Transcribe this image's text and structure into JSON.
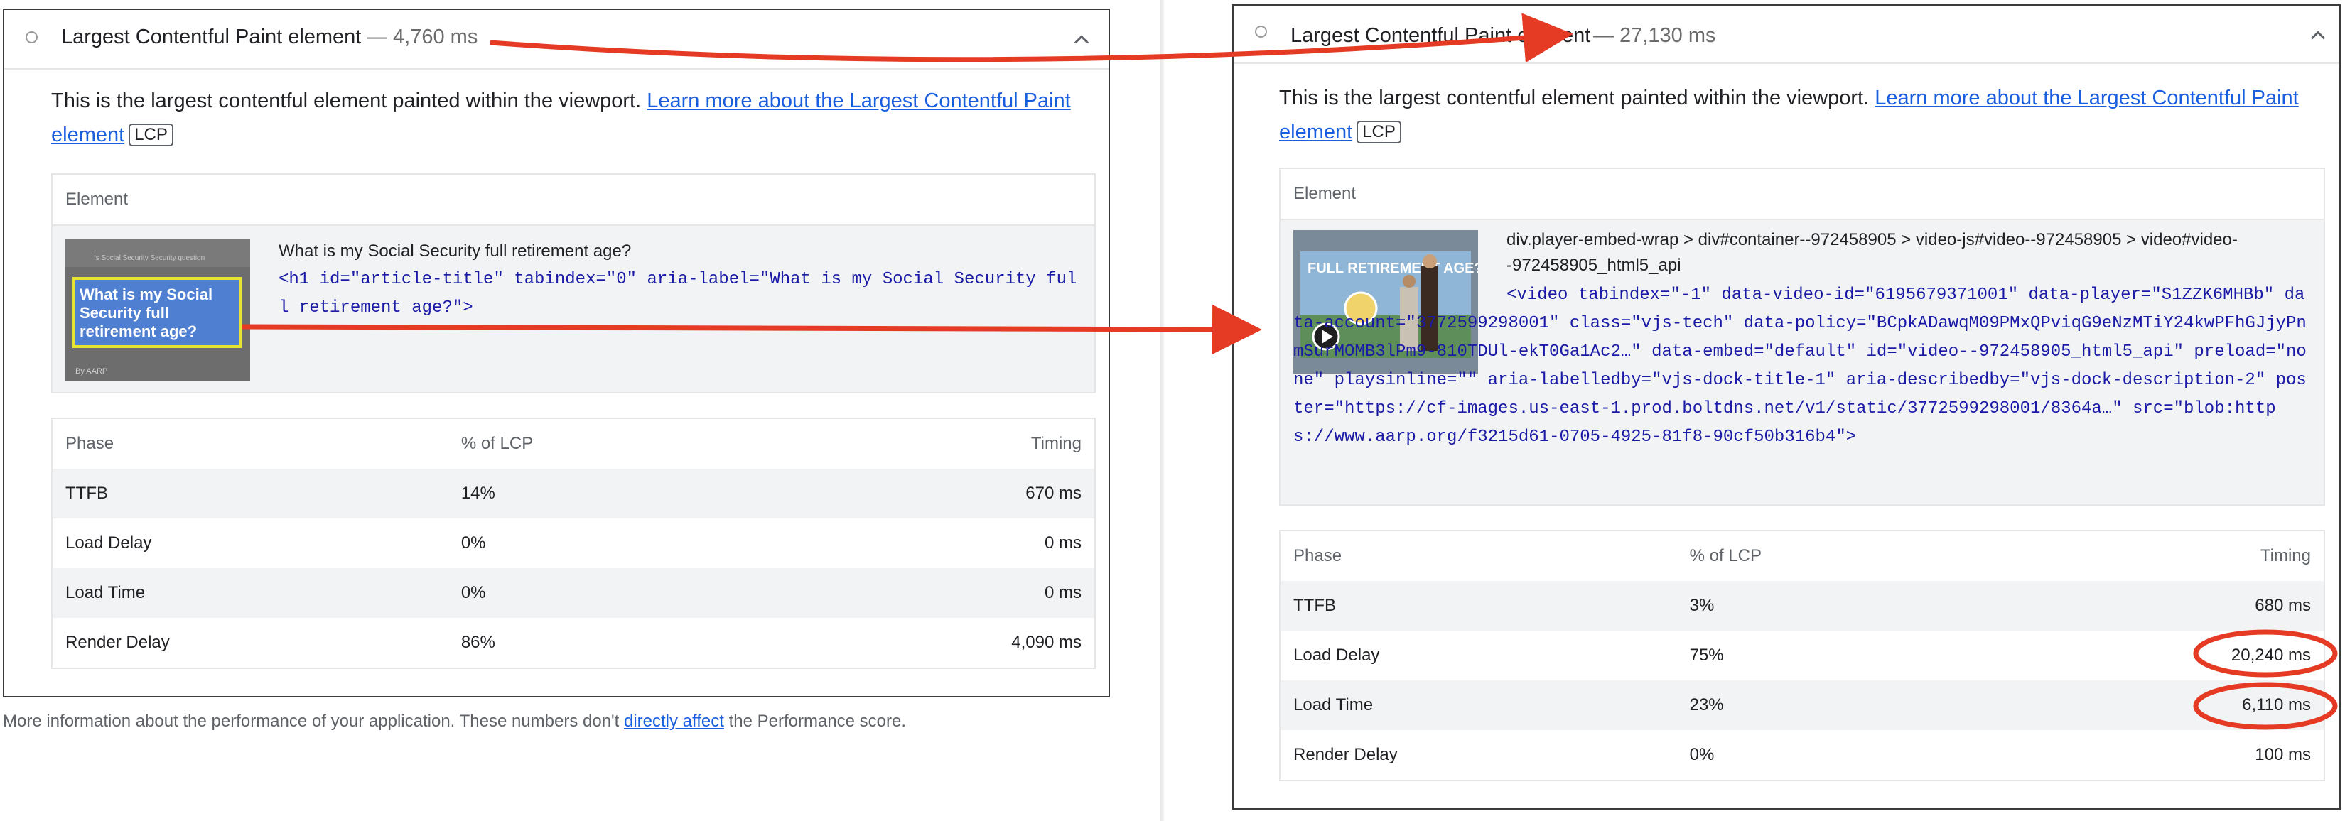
{
  "left": {
    "title": "Largest Contentful Paint element",
    "value": "— 4,760 ms",
    "desc_text": "This is the largest contentful element painted within the viewport. ",
    "desc_link": "Learn more about the Largest Contentful Paint element",
    "badge": "LCP",
    "element_header": "Element",
    "thumb": {
      "small_top": "Is Social Security Security question",
      "headline": "What is my Social Security full retirement age?",
      "byline": "By AARP"
    },
    "snippet_text": "What is my Social Security full retirement age?",
    "snippet_code": "<h1 id=\"article-title\" tabindex=\"0\" aria-label=\"What is my Social Security full retirement age?\">",
    "table": {
      "headers": [
        "Phase",
        "% of LCP",
        "Timing"
      ],
      "rows": [
        [
          "TTFB",
          "14%",
          "670 ms"
        ],
        [
          "Load Delay",
          "0%",
          "0 ms"
        ],
        [
          "Load Time",
          "0%",
          "0 ms"
        ],
        [
          "Render Delay",
          "86%",
          "4,090 ms"
        ]
      ]
    }
  },
  "footnote": {
    "before": "More information about the performance of your application. These numbers don't ",
    "link": "directly affect",
    "after": " the Performance score."
  },
  "right": {
    "title": "Largest Contentful Paint element",
    "value": "— 27,130 ms",
    "desc_text": "This is the largest contentful element painted within the viewport. ",
    "desc_link": "Learn more about the Largest Contentful Paint element",
    "badge": "LCP",
    "element_header": "Element",
    "thumb": {
      "headline": "FULL RETIREMENT AGE?"
    },
    "selector": "div.player-embed-wrap > div#container--972458905 > video-js#video--972458905 > video#video--972458905_html5_api",
    "snippet_code": "<video tabindex=\"-1\" data-video-id=\"6195679371001\" data-player=\"S1ZZK6MHBb\" data-account=\"3772599298001\" class=\"vjs-tech\" data-policy=\"BCpkADawqM09PMxQPviqG9eNzMTiY24kwPFhGJjyPnmSurMOMB3lPm9-810TDUl-ekT0Ga1Ac2…\" data-embed=\"default\" id=\"video--972458905_html5_api\" preload=\"none\" playsinline=\"\" aria-labelledby=\"vjs-dock-title-1\" aria-describedby=\"vjs-dock-description-2\" poster=\"https://cf-images.us-east-1.prod.boltdns.net/v1/static/3772599298001/8364a…\" src=\"blob:https://www.aarp.org/f3215d61-0705-4925-81f8-90cf50b316b4\">",
    "table": {
      "headers": [
        "Phase",
        "% of LCP",
        "Timing"
      ],
      "rows": [
        [
          "TTFB",
          "3%",
          "680 ms"
        ],
        [
          "Load Delay",
          "75%",
          "20,240 ms"
        ],
        [
          "Load Time",
          "23%",
          "6,110 ms"
        ],
        [
          "Render Delay",
          "0%",
          "100 ms"
        ]
      ]
    }
  },
  "colors": {
    "annotation": "#e53b25",
    "link": "#1a5ee0",
    "code": "#1a1aa6",
    "row_alt": "#f1f3f4"
  },
  "icons": [
    "radio-icon",
    "chevron-up-icon",
    "play-icon"
  ]
}
